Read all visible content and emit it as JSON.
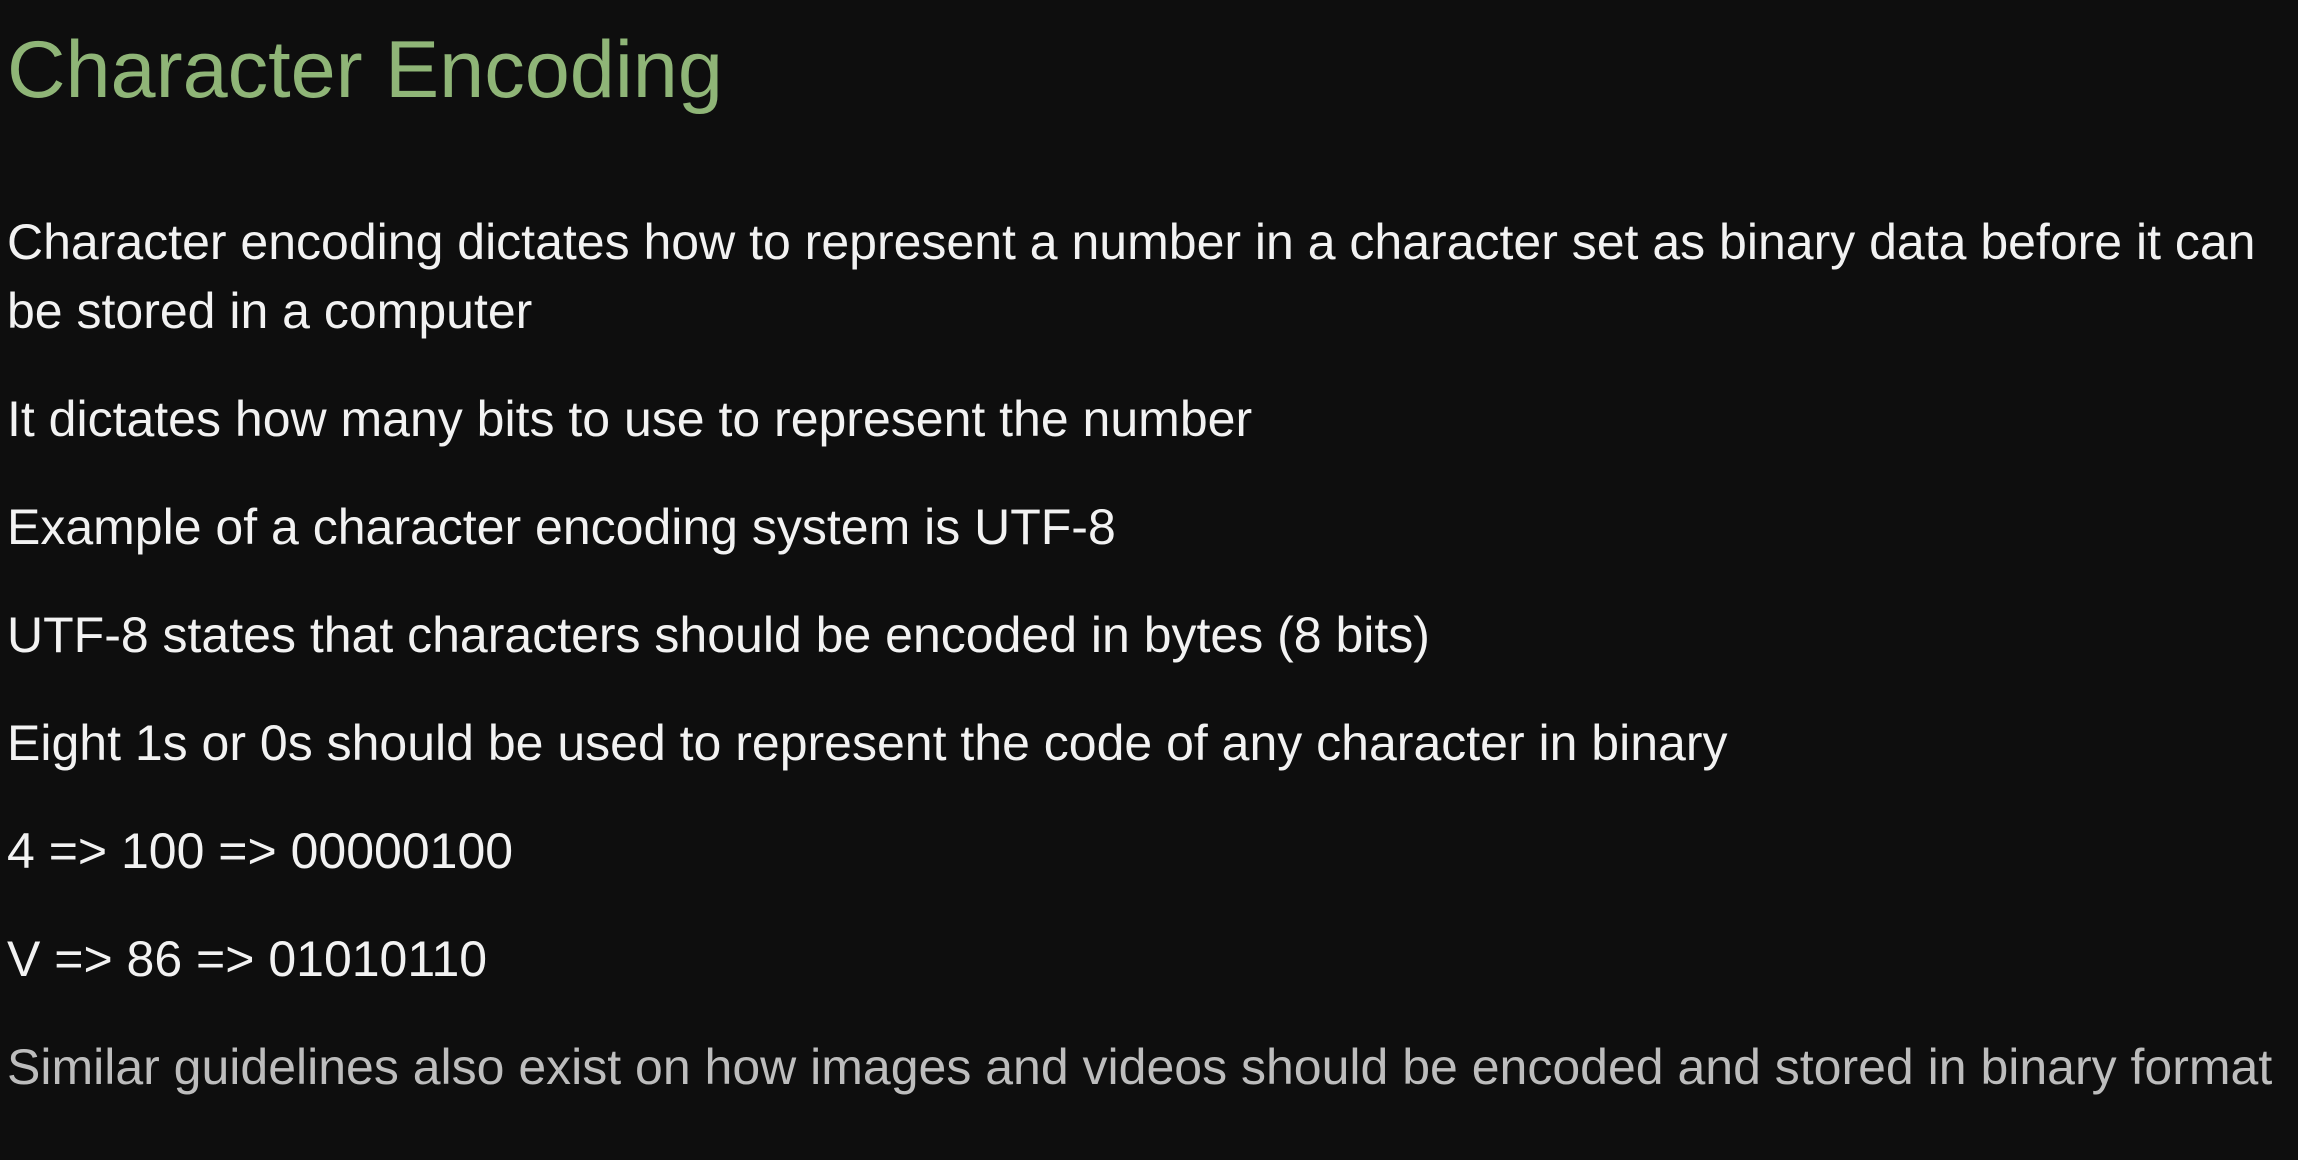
{
  "slide": {
    "title": "Character Encoding",
    "bullets": [
      "Character encoding dictates how to represent a number in a character set as binary data before it can be stored in a computer",
      "It dictates how many bits to use to represent the number",
      "Example of a character encoding system is UTF-8",
      "UTF-8 states that characters should be encoded in bytes (8 bits)",
      "Eight 1s or 0s should be used to represent the code of any character in binary",
      "4 => 100 => 00000100",
      "V => 86 => 01010110",
      "Similar guidelines also exist on how images and videos should be encoded and stored in binary format"
    ]
  },
  "colors": {
    "background": "#0e0e0e",
    "title": "#8fb577",
    "text": "#f2f2f2",
    "dim_text": "#bdbdbd"
  }
}
